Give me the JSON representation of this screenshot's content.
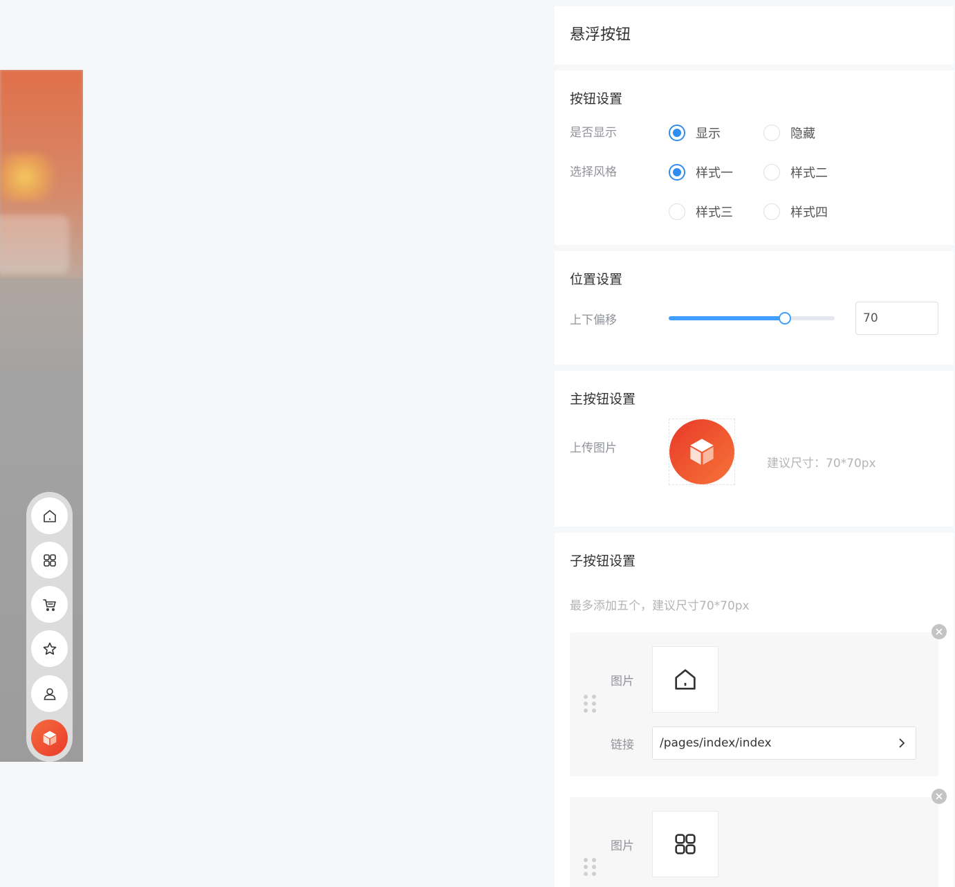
{
  "page_title": "悬浮按钮",
  "button_settings": {
    "title": "按钮设置",
    "show_label": "是否显示",
    "show_options": [
      {
        "label": "显示",
        "checked": true
      },
      {
        "label": "隐藏",
        "checked": false
      }
    ],
    "style_label": "选择风格",
    "style_options": [
      {
        "label": "样式一",
        "checked": true
      },
      {
        "label": "样式二",
        "checked": false
      },
      {
        "label": "样式三",
        "checked": false
      },
      {
        "label": "样式四",
        "checked": false
      }
    ]
  },
  "position_settings": {
    "title": "位置设置",
    "offset_label": "上下偏移",
    "offset_value": "70",
    "slider_fraction": 0.7
  },
  "main_button": {
    "title": "主按钮设置",
    "upload_label": "上传图片",
    "size_hint": "建议尺寸：70*70px",
    "image_icon": "cube-icon"
  },
  "sub_buttons": {
    "title": "子按钮设置",
    "hint": "最多添加五个，建议尺寸70*70px",
    "image_label": "图片",
    "link_label": "链接",
    "items": [
      {
        "icon": "home-icon",
        "link": "/pages/index/index"
      },
      {
        "icon": "grid-icon",
        "link": ""
      }
    ]
  },
  "preview": {
    "float_icons": [
      "home-icon",
      "grid-icon",
      "cart-icon",
      "star-icon",
      "user-icon"
    ],
    "main_icon": "cube-icon"
  },
  "colors": {
    "accent": "#2f8cf0",
    "main_button": "#ef4f2f"
  }
}
